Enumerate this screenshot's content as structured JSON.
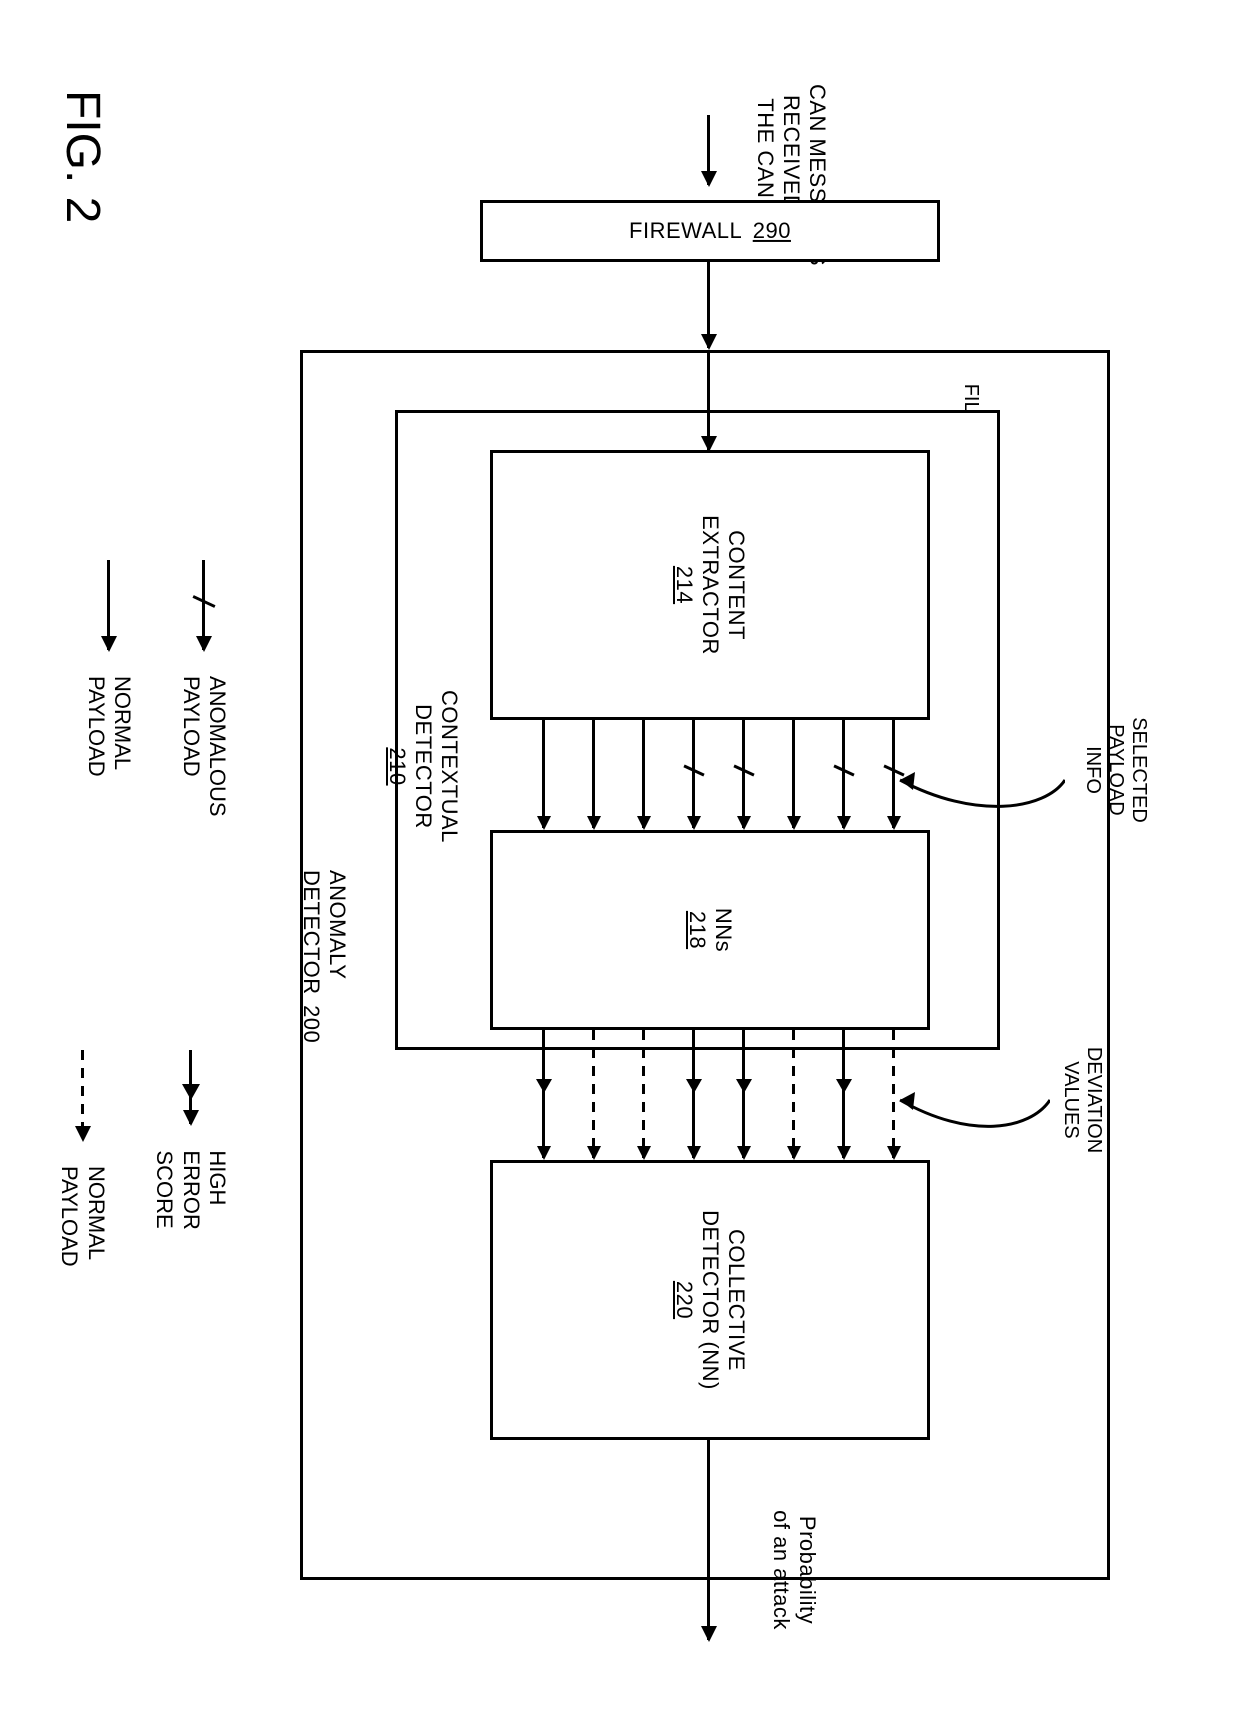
{
  "figure_label": "FIG. 2",
  "input_label": "CAN MESSAGES\nRECEIVED VIA\nTHE CAN BUS",
  "firewall": {
    "name": "FIREWALL",
    "ref": "290"
  },
  "filtered_label": "FILTERED SET OF\nMESSAGES",
  "selected_label": "SELECTED\nPAYLOAD\nINFO",
  "deviation_label": "DEVIATION\nVALUES",
  "anomaly_detector": {
    "name": "ANOMALY\nDETECTOR",
    "ref": "200"
  },
  "contextual_detector": {
    "name": "CONTEXTUAL\nDETECTOR",
    "ref": "210"
  },
  "content_extractor": {
    "name": "CONTENT\nEXTRACTOR",
    "ref": "214"
  },
  "nns": {
    "name": "NNs",
    "ref": "218"
  },
  "collective_detector": {
    "name": "COLLECTIVE\nDETECTOR (NN)",
    "ref": "220"
  },
  "output_label": "Probability\nof an attack",
  "legend": {
    "anomalous": "ANOMALOUS\nPAYLOAD",
    "normal_solid": "NORMAL\nPAYLOAD",
    "high_error": "HIGH ERROR\nSCORE",
    "normal_dashed": "NORMAL\nPAYLOAD"
  },
  "chart_data": {
    "type": "diagram",
    "flow": [
      "CAN MESSAGES RECEIVED VIA THE CAN BUS",
      "FIREWALL 290",
      "FILTERED SET OF MESSAGES",
      "ANOMALY DETECTOR 200",
      "Probability of an attack"
    ],
    "anomaly_detector_children": [
      {
        "name": "CONTEXTUAL DETECTOR 210",
        "children": [
          "CONTENT EXTRACTOR 214",
          "NNs 218"
        ],
        "internal_arrows": {
          "from": "CONTENT EXTRACTOR 214",
          "to": "NNs 218",
          "label": "SELECTED PAYLOAD INFO",
          "count": 8,
          "styles": [
            "anomalous",
            "anomalous",
            "normal",
            "anomalous",
            "anomalous",
            "normal",
            "normal",
            "normal"
          ]
        }
      },
      {
        "name": "COLLECTIVE DETECTOR (NN) 220"
      }
    ],
    "arrows_ctx_to_collective": {
      "from": "NNs 218",
      "to": "COLLECTIVE DETECTOR (NN) 220",
      "label": "DEVIATION VALUES",
      "count": 8,
      "styles": [
        "normal_dashed",
        "high_error",
        "normal_dashed",
        "high_error",
        "high_error",
        "normal_dashed",
        "normal_dashed",
        "high_error"
      ]
    },
    "legend_arrow_styles": {
      "anomalous": "solid line with diagonal tick through shaft, arrowhead",
      "normal_solid": "plain solid line, arrowhead",
      "high_error": "solid line with extra arrowhead marker on shaft, arrowhead",
      "normal_dashed": "dashed line, arrowhead"
    }
  }
}
